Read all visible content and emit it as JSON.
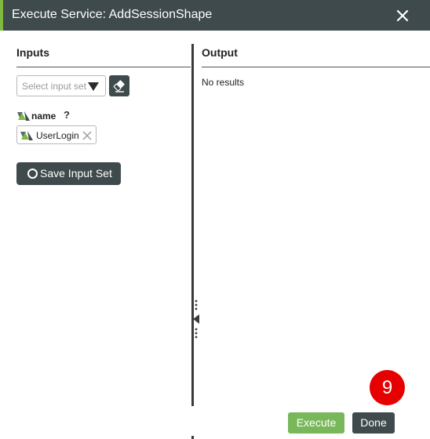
{
  "dialog": {
    "title": "Execute Service: AddSessionShape",
    "close_icon": "close-icon",
    "accent_color": "#7fb93f",
    "titlebar_color": "#3f4a4c"
  },
  "inputs": {
    "header": "Inputs",
    "input_set_select": {
      "placeholder": "Select input set",
      "caret_icon": "caret-down-icon"
    },
    "clear_button_icon": "eraser-icon",
    "parameter": {
      "icon": "thing-shape-icon",
      "name": "name",
      "help": "?",
      "value": "UserLogin",
      "remove_icon": "remove-x-icon"
    },
    "save_button": {
      "icon": "circle-icon",
      "label": "Save Input Set"
    }
  },
  "output": {
    "header": "Output",
    "message": "No results"
  },
  "footer": {
    "step_badge": "9",
    "badge_color": "#e60000",
    "execute_label": "Execute",
    "execute_color": "#79b85a",
    "done_label": "Done"
  }
}
